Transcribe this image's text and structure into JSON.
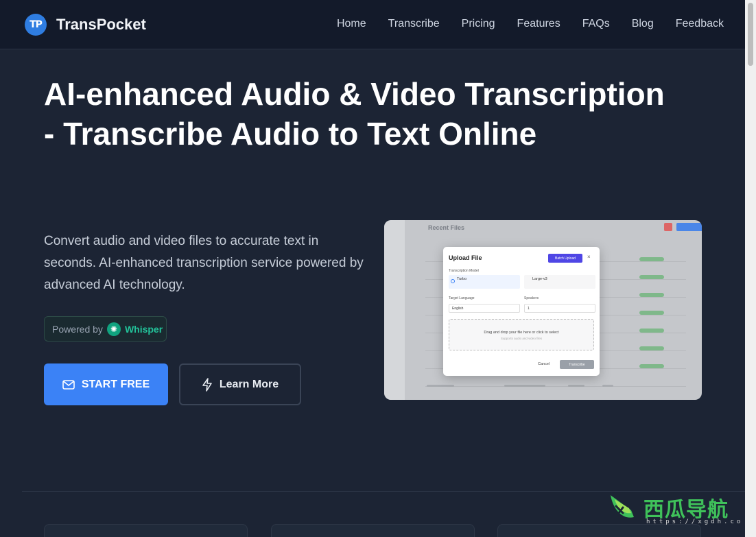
{
  "header": {
    "logo_mark": "TP",
    "brand": "TransPocket",
    "nav": [
      "Home",
      "Transcribe",
      "Pricing",
      "Features",
      "FAQs",
      "Blog",
      "Feedback"
    ]
  },
  "hero": {
    "title_line1": "AI-enhanced Audio & Video Transcription",
    "title_line2": "- Transcribe Audio to Text Online",
    "description": "Convert audio and video files to accurate text in seconds. AI-enhanced transcription service powered by advanced AI technology.",
    "powered_by": "Powered by",
    "powered_name": "Whisper",
    "cta_primary": "START FREE",
    "cta_secondary": "Learn More"
  },
  "preview": {
    "page_title": "Recent Files",
    "modal": {
      "title": "Upload File",
      "batch_button": "Batch Upload",
      "close": "×",
      "model_label": "Transcription Model",
      "model_option1": "Turbo",
      "model_option2": "Large-v3",
      "language_label": "Target Language",
      "language_value": "English",
      "speakers_label": "Speakers",
      "speakers_value": "1",
      "drop_text": "Drag and drop your file here or click to select",
      "drop_sub": "Supports audio and video files",
      "cancel": "Cancel",
      "transcribe": "Transcribe"
    }
  },
  "watermark": {
    "text": "西瓜导航",
    "url": "https://xgdh.co"
  },
  "colors": {
    "background": "#1c2434",
    "header": "#131a2a",
    "primary": "#3b82f6",
    "whisper_green": "#22c39a"
  }
}
